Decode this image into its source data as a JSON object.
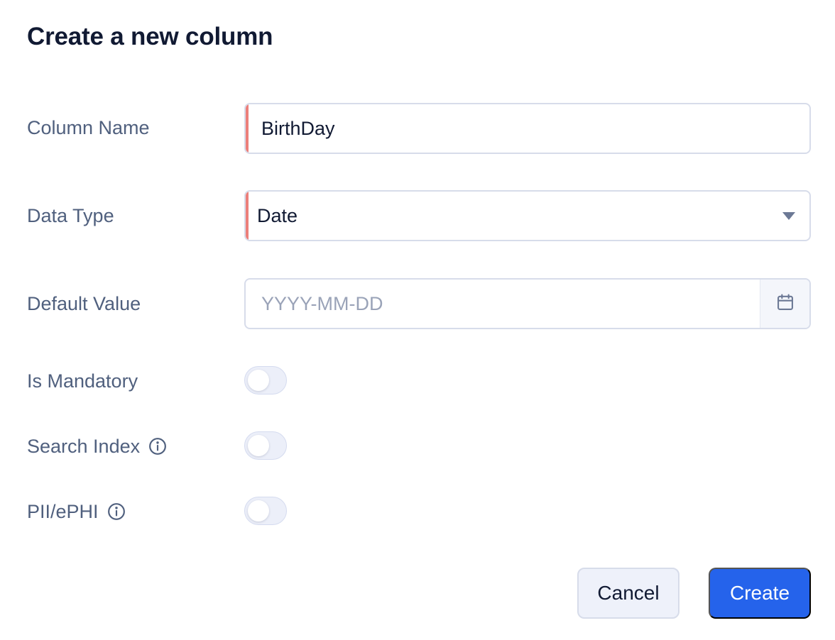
{
  "dialog": {
    "title": "Create a new column"
  },
  "form": {
    "column_name": {
      "label": "Column Name",
      "value": "BirthDay"
    },
    "data_type": {
      "label": "Data Type",
      "value": "Date"
    },
    "default_value": {
      "label": "Default Value",
      "placeholder": "YYYY-MM-DD",
      "icon": "calendar-icon"
    },
    "is_mandatory": {
      "label": "Is Mandatory",
      "enabled": false
    },
    "search_index": {
      "label": "Search Index",
      "enabled": false,
      "icon": "info-icon"
    },
    "pii_ephi": {
      "label": "PII/ePHI",
      "enabled": false,
      "icon": "info-icon"
    }
  },
  "actions": {
    "cancel_label": "Cancel",
    "create_label": "Create"
  },
  "colors": {
    "primary": "#2563eb",
    "error_accent": "#ec7f7a",
    "label_text": "#50607e",
    "title_text": "#111a33"
  }
}
